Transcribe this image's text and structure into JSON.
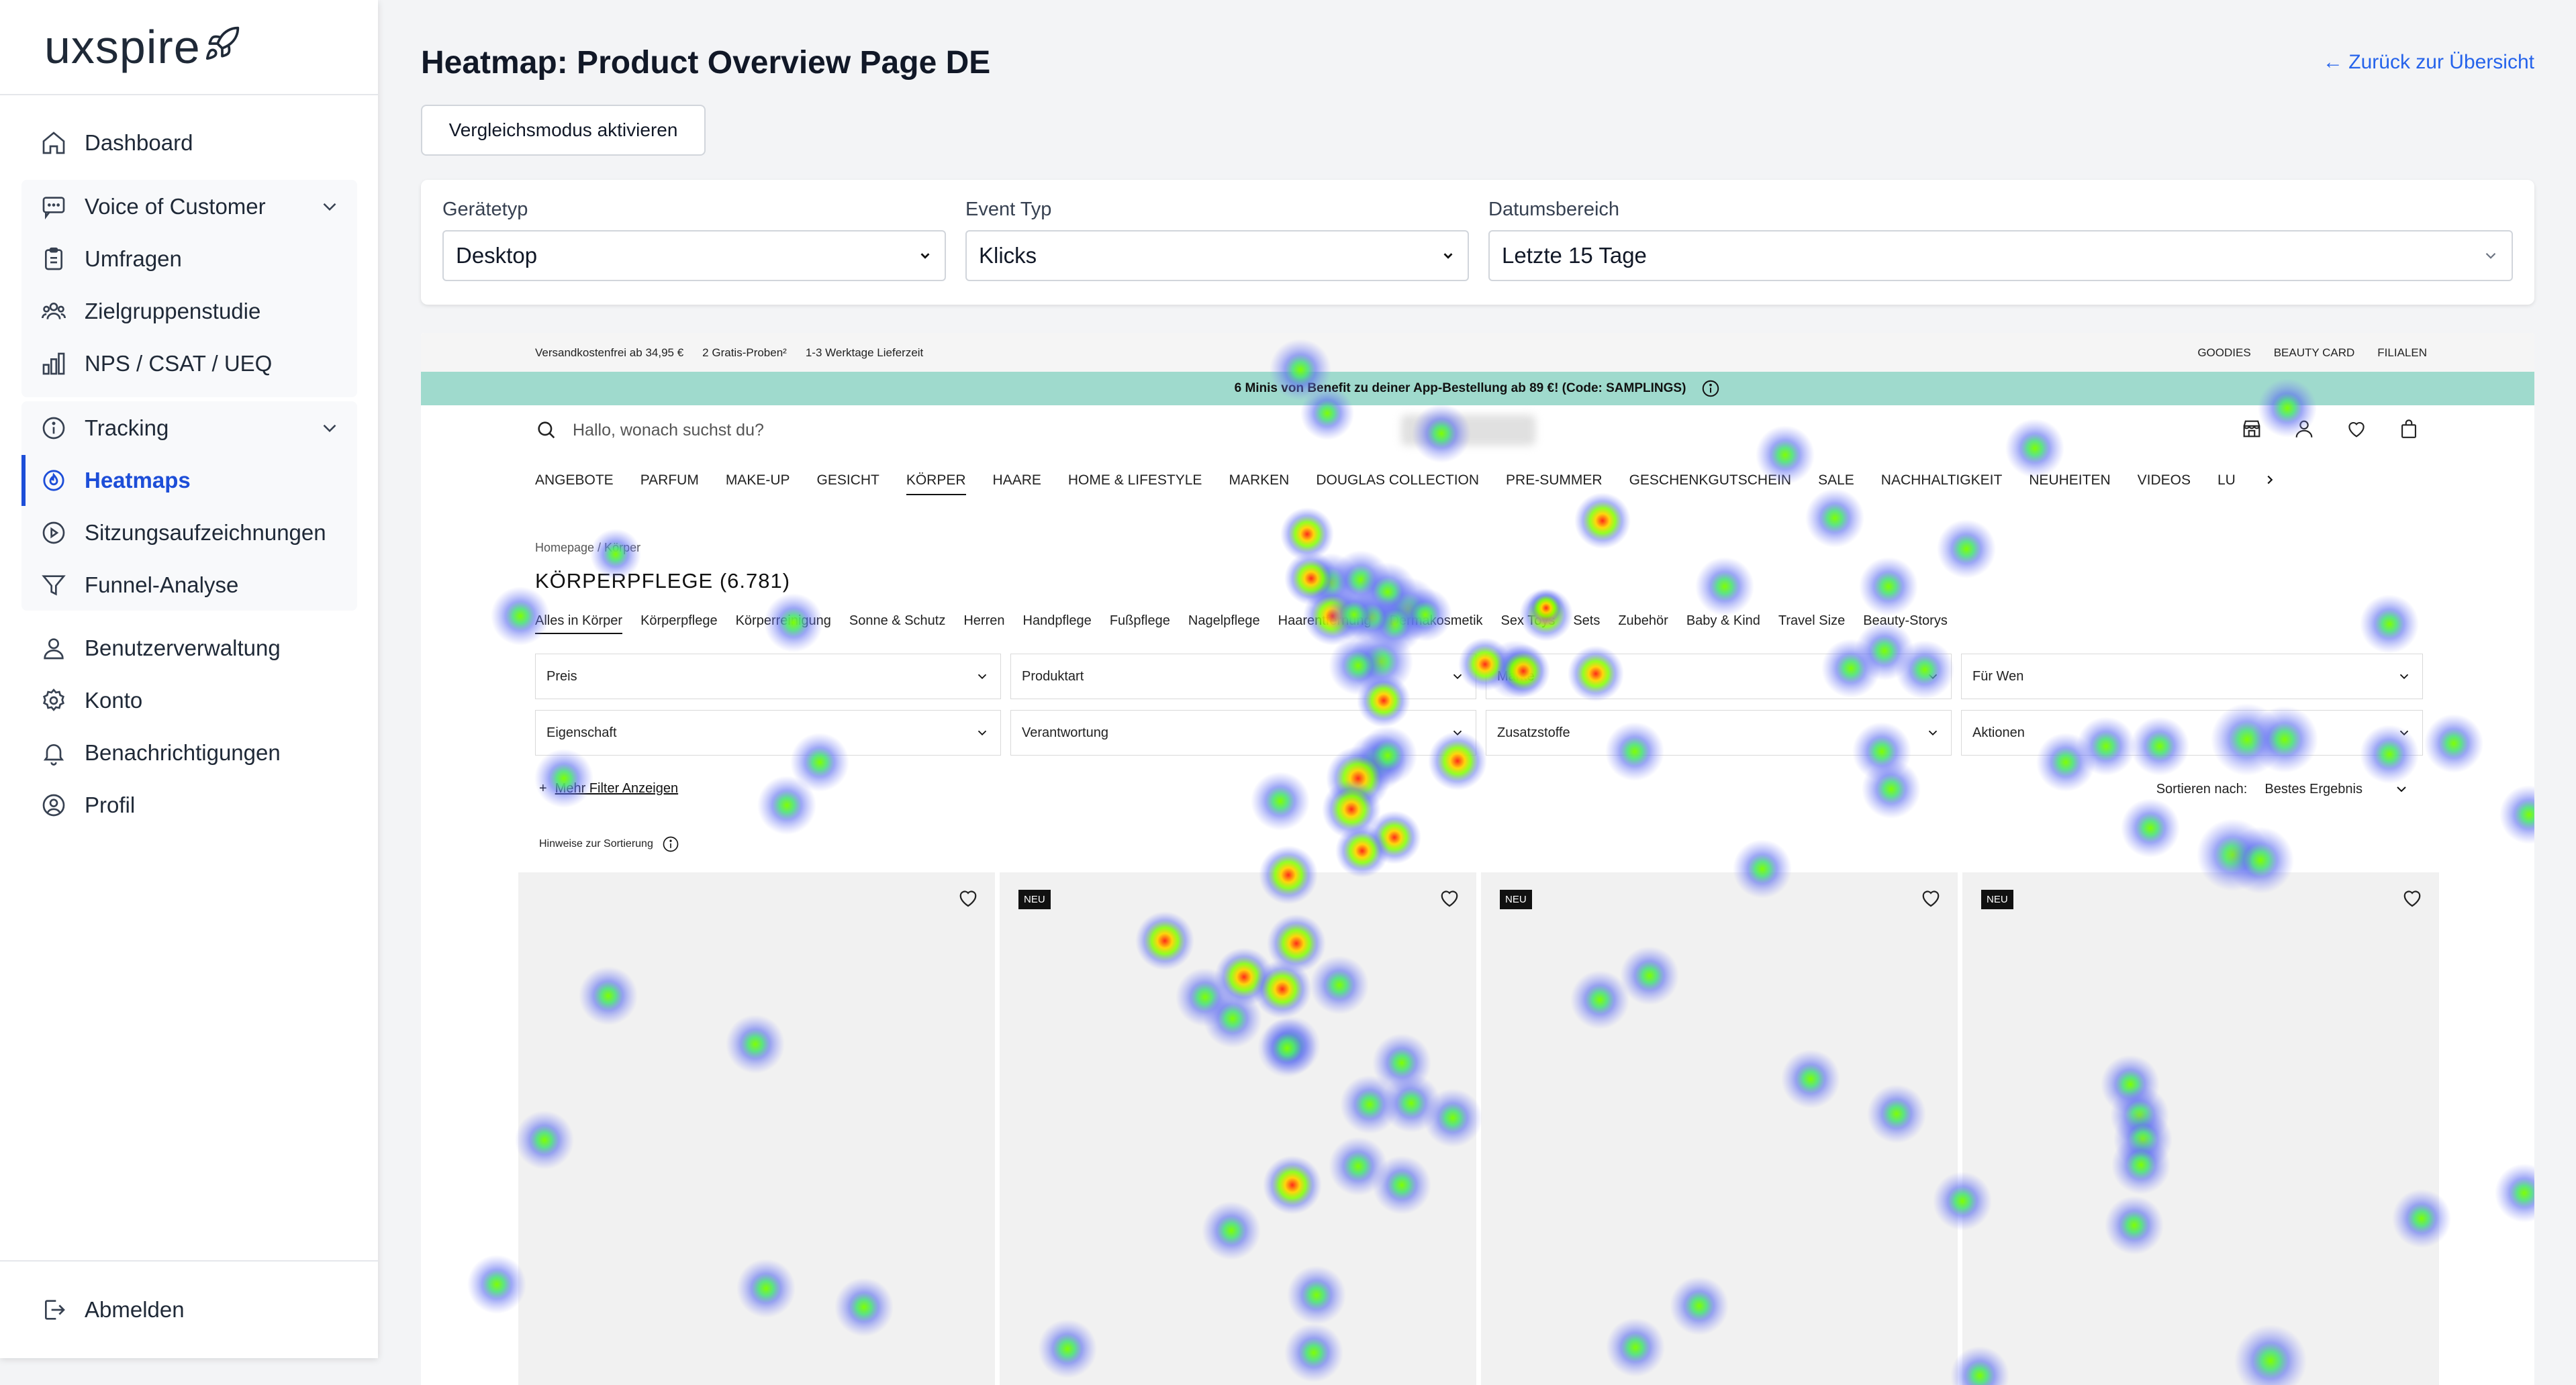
{
  "app": {
    "logo": "uxspire"
  },
  "sidebar": {
    "items": [
      {
        "key": "dashboard",
        "label": "Dashboard",
        "icon": "home-icon"
      },
      {
        "key": "voc",
        "label": "Voice of Customer",
        "icon": "message-icon"
      },
      {
        "key": "umfragen",
        "label": "Umfragen",
        "icon": "clipboard-icon"
      },
      {
        "key": "zielgruppenstudie",
        "label": "Zielgruppenstudie",
        "icon": "users-icon"
      },
      {
        "key": "nps",
        "label": "NPS / CSAT / UEQ",
        "icon": "bar-chart-icon"
      },
      {
        "key": "tracking",
        "label": "Tracking",
        "icon": "info-icon"
      },
      {
        "key": "heatmaps",
        "label": "Heatmaps",
        "icon": "heatmap-icon"
      },
      {
        "key": "sitzungen",
        "label": "Sitzungsaufzeichnungen",
        "icon": "play-circle-icon"
      },
      {
        "key": "funnel",
        "label": "Funnel-Analyse",
        "icon": "funnel-icon"
      },
      {
        "key": "benutzer",
        "label": "Benutzerverwaltung",
        "icon": "user-group-icon"
      },
      {
        "key": "konto",
        "label": "Konto",
        "icon": "gear-icon"
      },
      {
        "key": "benachrichtigungen",
        "label": "Benachrichtigungen",
        "icon": "bell-icon"
      },
      {
        "key": "profil",
        "label": "Profil",
        "icon": "user-circle-icon"
      }
    ],
    "logout": "Abmelden"
  },
  "header": {
    "title": "Heatmap: Product Overview Page DE",
    "back_link": "← Zurück zur Übersicht",
    "compare_button": "Vergleichsmodus aktivieren"
  },
  "filters": {
    "device": {
      "label": "Gerätetyp",
      "value": "Desktop"
    },
    "event": {
      "label": "Event Typ",
      "value": "Klicks"
    },
    "range": {
      "label": "Datumsbereich",
      "value": "Letzte 15 Tage"
    }
  },
  "preview": {
    "topbar_left": [
      "Versandkostenfrei ab 34,95 €",
      "2 Gratis-Proben²",
      "1-3 Werktage Lieferzeit"
    ],
    "topbar_right": [
      "GOODIES",
      "BEAUTY CARD",
      "FILIALEN"
    ],
    "promo": "6 Minis von Benefit zu deiner App-Bestellung ab 89 €! (Code: SAMPLINGS)",
    "search_placeholder": "Hallo, wonach suchst du?",
    "nav": [
      "ANGEBOTE",
      "PARFUM",
      "MAKE-UP",
      "GESICHT",
      "KÖRPER",
      "HAARE",
      "HOME & LIFESTYLE",
      "MARKEN",
      "DOUGLAS COLLECTION",
      "PRE-SUMMER",
      "GESCHENKGUTSCHEIN",
      "SALE",
      "NACHHALTIGKEIT",
      "NEUHEITEN",
      "VIDEOS",
      "LU"
    ],
    "breadcrumb": "Homepage / Körper",
    "heading": "KÖRPERPFLEGE (6.781)",
    "categories": [
      "Alles in Körper",
      "Körperpflege",
      "Körperreinigung",
      "Sonne & Schutz",
      "Herren",
      "Handpflege",
      "Fußpflege",
      "Nagelpflege",
      "Haarentfernung",
      "Dermakosmetik",
      "Sex Toys",
      "Sets",
      "Zubehör",
      "Baby & Kind",
      "Travel Size",
      "Beauty-Storys"
    ],
    "filters_row1": [
      "Preis",
      "Produktart",
      "Marke",
      "Für Wen"
    ],
    "filters_row2": [
      "Eigenschaft",
      "Verantwortung",
      "Zusatzstoffe",
      "Aktionen"
    ],
    "more_filters": "Mehr Filter Anzeigen",
    "sort_label": "Sortieren nach:",
    "sort_value": "Bestes Ergebnis",
    "sort_hint": "Hinweise zur Sortierung",
    "badge": "NEU"
  }
}
